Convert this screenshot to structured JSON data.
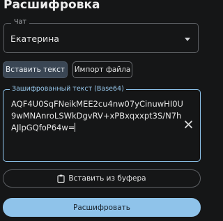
{
  "header": {
    "title": "Расшифровка"
  },
  "chat_select": {
    "label": "Чат",
    "value": "Екатерина"
  },
  "tabs": [
    {
      "label": "Вставить текст",
      "active": true
    },
    {
      "label": "Импорт файла",
      "active": false
    }
  ],
  "cipher_field": {
    "label": "Зашифрованный текст (Base64)",
    "value": "AQF4U0SqFNeikMEE2cu4nw07yCinuwHI0U9wMNAnroLSWkDgvRV+xPBxqxxpt3S/N7hAJlpGQfoP64w="
  },
  "paste_button": {
    "label": "Вставить из буфера"
  },
  "decrypt_button": {
    "label": "Расшифровать"
  },
  "colors": {
    "accent": "#8fc3ea",
    "active_tab": "#3a4654",
    "background": "#151617"
  },
  "icons": {
    "dropdown": "chevron-down-icon",
    "clear": "close-icon",
    "paste": "clipboard-icon"
  }
}
